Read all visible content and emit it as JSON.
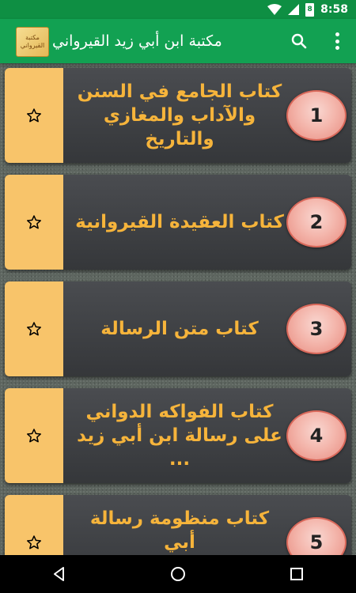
{
  "status_bar": {
    "time": "8:58",
    "battery_level": "8"
  },
  "app_bar": {
    "logo_text": "مكتبة القيرواني",
    "title": "مكتبة ابن أبي زيد القيرواني",
    "search_icon": "search-icon",
    "menu_icon": "more-vert-icon"
  },
  "books": [
    {
      "number": "1",
      "title": "كتاب الجامع في السنن\nوالآداب والمغازي والتاريخ",
      "favorite_icon": "star-outline-icon"
    },
    {
      "number": "2",
      "title": "كتاب العقيدة القيروانية",
      "favorite_icon": "star-outline-icon"
    },
    {
      "number": "3",
      "title": "كتاب متن الرسالة",
      "favorite_icon": "star-outline-icon"
    },
    {
      "number": "4",
      "title": "كتاب الفواكه الدواني\nعلى رسالة ابن أبي زيد ...",
      "favorite_icon": "star-outline-icon"
    },
    {
      "number": "5",
      "title": "كتاب منظومة رسالة أبي\nزيد القيرواني -الباكورة",
      "favorite_icon": "star-outline-icon"
    }
  ],
  "colors": {
    "status_bar": "#0e8f43",
    "app_bar": "#12a152",
    "fav_panel": "#f8c46a",
    "title_text": "#f6b43b"
  }
}
